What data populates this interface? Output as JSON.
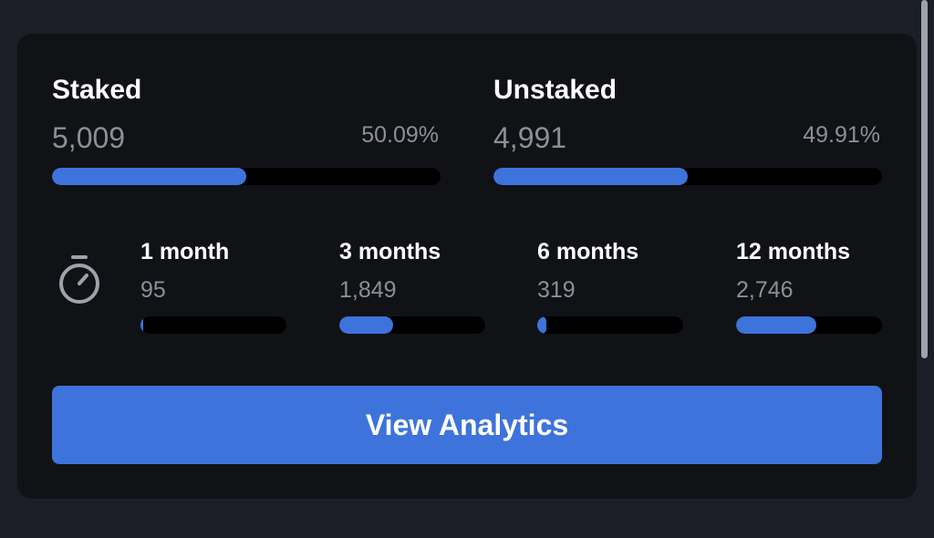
{
  "staked": {
    "title": "Staked",
    "value": "5,009",
    "percent": "50.09%",
    "fraction": 0.5009
  },
  "unstaked": {
    "title": "Unstaked",
    "value": "4,991",
    "percent": "49.91%",
    "fraction": 0.4991
  },
  "periods": [
    {
      "label": "1 month",
      "value": "95",
      "fraction": 0.019
    },
    {
      "label": "3 months",
      "value": "1,849",
      "fraction": 0.369
    },
    {
      "label": "6 months",
      "value": "319",
      "fraction": 0.064
    },
    {
      "label": "12 months",
      "value": "2,746",
      "fraction": 0.548
    }
  ],
  "timer_icon": "stopwatch-icon",
  "cta": {
    "label": "View Analytics"
  },
  "colors": {
    "accent": "#3d73db",
    "card": "#101216",
    "page": "#1b1e26",
    "muted_text": "#8b9097",
    "track": "#000000"
  }
}
